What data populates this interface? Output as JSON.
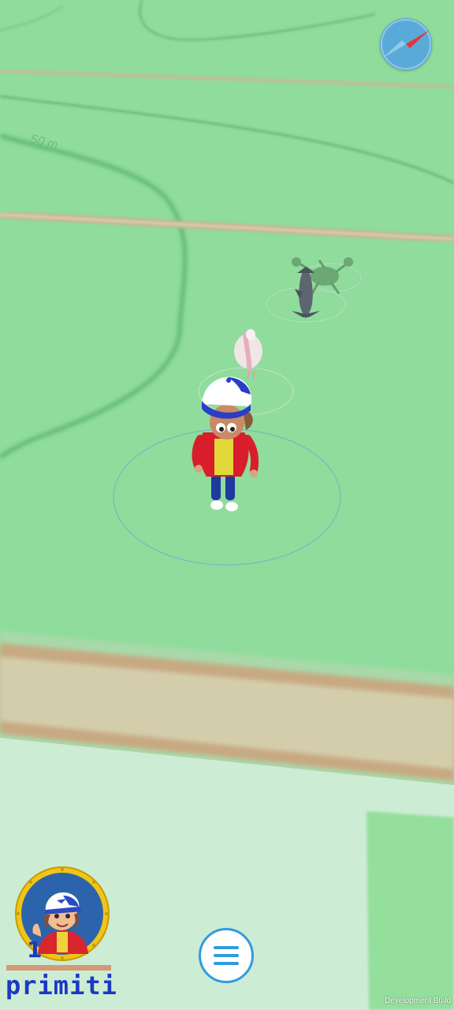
{
  "map": {
    "contour_label": "50 m",
    "land_color": "#8fdc9c",
    "road_color": "#d3c9a8",
    "creatures": [
      "dolphin",
      "lobster",
      "pelican"
    ]
  },
  "hud": {
    "compass_icon": "compass-icon",
    "player": {
      "level": "1",
      "name": "primiti"
    },
    "menu_icon": "hamburger-menu-icon",
    "build_label": "Development Build"
  }
}
